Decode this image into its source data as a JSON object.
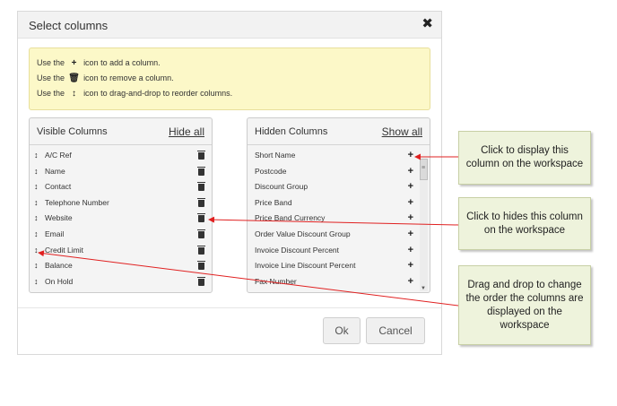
{
  "dialog": {
    "title": "Select columns",
    "close_glyph": "✖",
    "info": [
      {
        "before": "Use the",
        "icon": "plus-icon",
        "glyph": "+",
        "after": "icon to add a column."
      },
      {
        "before": "Use the",
        "icon": "trash-icon",
        "glyph": "🗑",
        "after": "icon to remove a column."
      },
      {
        "before": "Use the",
        "icon": "drag-icon",
        "glyph": "↕",
        "after": "icon to drag-and-drop to reorder columns."
      }
    ],
    "visible": {
      "title": "Visible Columns",
      "action": "Hide all",
      "items": [
        "A/C Ref",
        "Name",
        "Contact",
        "Telephone Number",
        "Website",
        "Email",
        "Credit Limit",
        "Balance",
        "On Hold"
      ]
    },
    "hidden": {
      "title": "Hidden Columns",
      "action": "Show all",
      "items": [
        "Short Name",
        "Postcode",
        "Discount Group",
        "Price Band",
        "Price Band Currency",
        "Order Value Discount Group",
        "Invoice Discount Percent",
        "Invoice Line Discount Percent",
        "Fax Number"
      ]
    },
    "ok_label": "Ok",
    "cancel_label": "Cancel"
  },
  "callouts": [
    "Click to display this column on the workspace",
    "Click to hides this column on the workspace",
    "Drag and drop to change the order the columns are displayed on the workspace"
  ],
  "colors": {
    "info_bg": "#fcf8c8",
    "callout_bg": "#eef3dc",
    "arrow": "#e02020"
  }
}
